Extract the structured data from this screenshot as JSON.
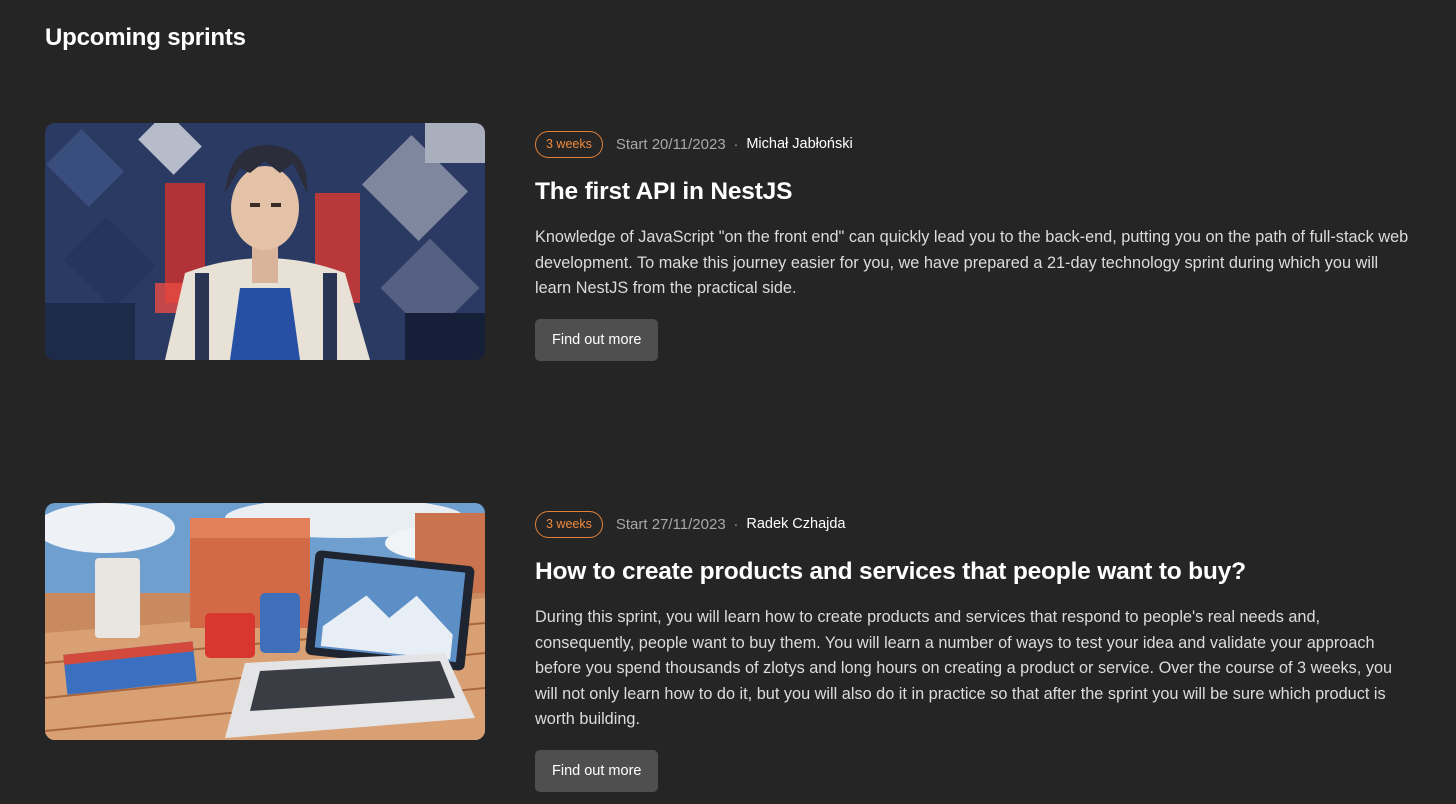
{
  "section_title": "Upcoming sprints",
  "accent_color": "#f08a3e",
  "sprints": [
    {
      "duration": "3 weeks",
      "start": "Start 20/11/2023",
      "separator": "·",
      "author": "Michał Jabłoński",
      "title": "The first API in NestJS",
      "description": "Knowledge of JavaScript \"on the front end\" can quickly lead you to the back-end, putting you on the path of full-stack web development. To make this journey easier for you, we have prepared a 21-day technology sprint during which you will learn NestJS from the practical side.",
      "button": "Find out more"
    },
    {
      "duration": "3 weeks",
      "start": "Start 27/11/2023",
      "separator": "·",
      "author": "Radek Czhajda",
      "title": "How to create products and services that people want to buy?",
      "description": "During this sprint, you will learn how to create products and services that respond to people's real needs and, consequently, people want to buy them. You will learn a number of ways to test your idea and validate your approach before you spend thousands of zlotys and long hours on creating a product or service. Over the course of 3 weeks, you will not only learn how to do it, but you will also do it in practice so that after the sprint you will be sure which product is worth building.",
      "button": "Find out more"
    }
  ]
}
